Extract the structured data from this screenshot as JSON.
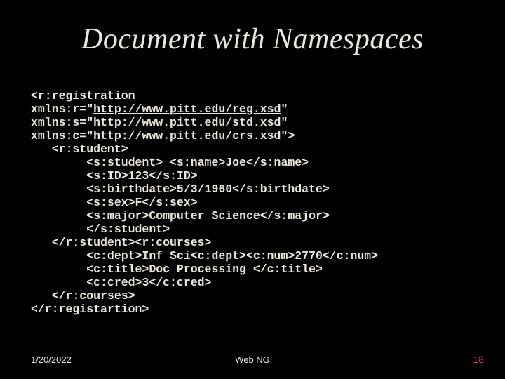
{
  "title": "Document with Namespaces",
  "code": {
    "l1": "<r:registration",
    "l2a": "xmlns:r=\"",
    "l2b": "http://www.pitt.edu/reg.xsd",
    "l2c": "\"",
    "l3": "xmlns:s=\"http://www.pitt.edu/std.xsd\"",
    "l4": "xmlns:c=\"http://www.pitt.edu/crs.xsd\">",
    "l5": "   <r:student>",
    "l6": "        <s:student> <s:name>Joe</s:name>",
    "l7": "        <s:ID>123</s:ID>",
    "l8": "        <s:birthdate>5/3/1960</s:birthdate>",
    "l9": "        <s:sex>F</s:sex>",
    "l10": "        <s:major>Computer Science</s:major>",
    "l11": "        </s:student>",
    "l12": "   </r:student><r:courses>",
    "l13": "        <c:dept>Inf Sci<c:dept><c:num>2770</c:num>",
    "l14": "        <c:title>Doc Processing </c:title>",
    "l15": "        <c:cred>3</c:cred>",
    "l16": "   </r:courses>",
    "l17": "</r:registartion>"
  },
  "footer": {
    "date": "1/20/2022",
    "center": "Web NG",
    "pagenum": "18"
  }
}
